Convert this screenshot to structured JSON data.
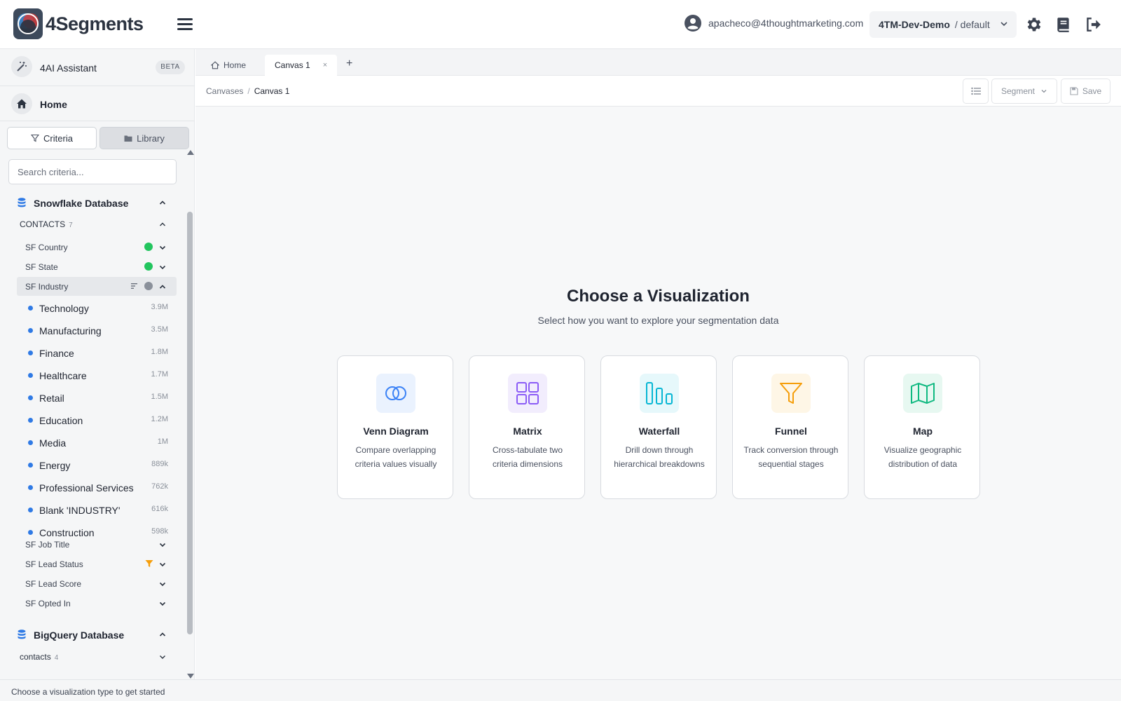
{
  "header": {
    "logo_text": "4Segments",
    "user_email": "apacheco@4thoughtmarketing.com",
    "org_name": "4TM-Dev-Demo",
    "org_workspace": "/ default"
  },
  "sidebar": {
    "ai_label": "4AI Assistant",
    "beta_badge": "BETA",
    "home_label": "Home",
    "tabs": [
      {
        "label": "Criteria",
        "icon": "filter-icon"
      },
      {
        "label": "Library",
        "icon": "folder-icon"
      }
    ],
    "search_placeholder": "Search criteria...",
    "databases": [
      {
        "name": "Snowflake Database",
        "object": {
          "name": "CONTACTS",
          "count": "7"
        },
        "fields": [
          {
            "label": "SF Country",
            "indicator": "globe-green"
          },
          {
            "label": "SF State",
            "indicator": "globe-green"
          },
          {
            "label": "SF Industry",
            "indicator": "globe-gray"
          }
        ],
        "values": [
          {
            "label": "Technology",
            "count": "3.9M"
          },
          {
            "label": "Manufacturing",
            "count": "3.5M"
          },
          {
            "label": "Finance",
            "count": "1.8M"
          },
          {
            "label": "Healthcare",
            "count": "1.7M"
          },
          {
            "label": "Retail",
            "count": "1.5M"
          },
          {
            "label": "Education",
            "count": "1.2M"
          },
          {
            "label": "Media",
            "count": "1M"
          },
          {
            "label": "Energy",
            "count": "889k"
          },
          {
            "label": "Professional Services",
            "count": "762k"
          },
          {
            "label": "Blank 'INDUSTRY'",
            "count": "616k"
          },
          {
            "label": "Construction",
            "count": "598k"
          }
        ],
        "more_fields": [
          {
            "label": "SF Job Title"
          },
          {
            "label": "SF Lead Status",
            "indicator": "filter-orange"
          },
          {
            "label": "SF Lead Score"
          },
          {
            "label": "SF Opted In"
          }
        ]
      },
      {
        "name": "BigQuery Database",
        "object": {
          "name": "contacts",
          "count": "4"
        }
      }
    ]
  },
  "tabs": [
    {
      "label": "Home",
      "icon": "home-icon"
    },
    {
      "label": "Canvas 1",
      "close": "×"
    }
  ],
  "tab_add": "+",
  "breadcrumb": {
    "parent": "Canvases",
    "separator": "/",
    "current": "Canvas 1"
  },
  "toolbar": {
    "segment_label": "Segment",
    "save_label": "Save"
  },
  "canvas": {
    "title": "Choose a Visualization",
    "subtitle": "Select how you want to explore your segmentation data",
    "cards": [
      {
        "title": "Venn Diagram",
        "desc": "Compare overlapping criteria values visually",
        "icon": "venn-icon",
        "color": "#3b82f6",
        "bg": "#eaf2fe"
      },
      {
        "title": "Matrix",
        "desc": "Cross-tabulate two criteria dimensions",
        "icon": "grid-icon",
        "color": "#8b5cf6",
        "bg": "#f2edfd"
      },
      {
        "title": "Waterfall",
        "desc": "Drill down through hierarchical breakdowns",
        "icon": "waterfall-icon",
        "color": "#06b6d4",
        "bg": "#e6f8fb"
      },
      {
        "title": "Funnel",
        "desc": "Track conversion through sequential stages",
        "icon": "funnel-icon",
        "color": "#f59e0b",
        "bg": "#fef6e6"
      },
      {
        "title": "Map",
        "desc": "Visualize geographic distribution of data",
        "icon": "map-icon",
        "color": "#10b981",
        "bg": "#e7f8f1"
      }
    ]
  },
  "status_text": "Choose a visualization type to get started",
  "colors": {
    "accent_blue": "#2f7ae5",
    "globe_green": "#22c55e",
    "filter_orange": "#f59e0b"
  }
}
